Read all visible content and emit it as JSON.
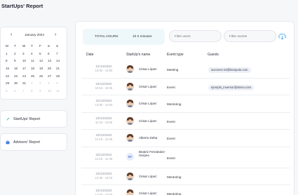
{
  "page": {
    "title": "StartUps' Report"
  },
  "calendar": {
    "month_label": "January 2024",
    "prev_arrow": "‹",
    "next_arrow": "›",
    "weekdays": [
      "M",
      "T",
      "W",
      "T",
      "F",
      "S",
      "S"
    ],
    "days": [
      {
        "d": "1",
        "muted": false
      },
      {
        "d": "2",
        "muted": false
      },
      {
        "d": "3",
        "muted": false
      },
      {
        "d": "4",
        "muted": false
      },
      {
        "d": "5",
        "muted": false
      },
      {
        "d": "6",
        "muted": false
      },
      {
        "d": "7",
        "muted": false
      },
      {
        "d": "8",
        "muted": false
      },
      {
        "d": "9",
        "muted": false
      },
      {
        "d": "10",
        "muted": false
      },
      {
        "d": "11",
        "muted": false
      },
      {
        "d": "12",
        "muted": false
      },
      {
        "d": "13",
        "muted": false
      },
      {
        "d": "14",
        "muted": false
      },
      {
        "d": "15",
        "muted": false
      },
      {
        "d": "16",
        "muted": false
      },
      {
        "d": "17",
        "muted": false
      },
      {
        "d": "18",
        "muted": false
      },
      {
        "d": "19",
        "muted": false
      },
      {
        "d": "20",
        "muted": false
      },
      {
        "d": "21",
        "muted": false
      },
      {
        "d": "22",
        "muted": false
      },
      {
        "d": "23",
        "muted": false
      },
      {
        "d": "24",
        "muted": false
      },
      {
        "d": "25",
        "muted": false
      },
      {
        "d": "26",
        "muted": false
      },
      {
        "d": "27",
        "muted": false
      },
      {
        "d": "28",
        "muted": false
      },
      {
        "d": "29",
        "muted": false
      },
      {
        "d": "30",
        "muted": false
      },
      {
        "d": "31",
        "muted": false
      },
      {
        "d": "1",
        "muted": true
      },
      {
        "d": "2",
        "muted": true
      },
      {
        "d": "3",
        "muted": true
      },
      {
        "d": "4",
        "muted": true
      },
      {
        "d": "5",
        "muted": true
      },
      {
        "d": "6",
        "muted": true
      },
      {
        "d": "7",
        "muted": true
      },
      {
        "d": "8",
        "muted": true
      },
      {
        "d": "9",
        "muted": true
      },
      {
        "d": "10",
        "muted": true
      },
      {
        "d": "11",
        "muted": true
      }
    ]
  },
  "nav": {
    "startups_report": {
      "label": "StartUps' Report",
      "icon": "rocket-icon",
      "color": "#2bb3a3"
    },
    "advisors_report": {
      "label": "Advisors' Report",
      "icon": "briefcase-icon",
      "color": "#3c7be0"
    }
  },
  "summary": {
    "total_label": "TOTAL HOURS",
    "total_value": "1h 0 minutes"
  },
  "filters": {
    "users_placeholder": "Filter users",
    "events_placeholder": "Filter events",
    "download_icon": "cloud-download-icon",
    "download_color": "#4aa8e8"
  },
  "table": {
    "columns": [
      "Date",
      "StartUp's name",
      "Event type",
      "Guests"
    ],
    "rows": [
      {
        "date": "21/12/2022",
        "time": "13:30 - 14:00",
        "name": "César López",
        "avatar": "photo",
        "type": "Meeting",
        "guest": "success+23@lanspots.com"
      },
      {
        "date": "22/12/2022",
        "time": "18:15 - 18:45",
        "name": "César López",
        "avatar": "photo",
        "type": "Event",
        "guest": "ejemplo_inversor@demo.com"
      },
      {
        "date": "22/12/2022",
        "time": "13:30 - 14:00",
        "name": "César López",
        "avatar": "photo",
        "type": "Mentoring",
        "guest": ""
      },
      {
        "date": "23/12/2022",
        "time": "11:15 - 13:00",
        "name": "César López",
        "avatar": "photo",
        "type": "Event",
        "guest": ""
      },
      {
        "date": "23/12/2022",
        "time": "12:15 - 12:45",
        "name": "Alberto Deba",
        "avatar": "photo",
        "type": "Event",
        "guest": ""
      },
      {
        "date": "23/12/2022",
        "time": "12:15 - 12:45",
        "name": "Beatriz Fernández-Gerpeo",
        "avatar": "BF",
        "type": "Event",
        "guest": ""
      },
      {
        "date": "23/12/2022",
        "time": "12:45 - 13:15",
        "name": "César López",
        "avatar": "photo",
        "type": "Mentoring",
        "guest": ""
      },
      {
        "date": "23/12/2022",
        "time": "14:30 - 15:00",
        "name": "César López",
        "avatar": "photo",
        "type": "Mentoring",
        "guest": ""
      }
    ]
  }
}
